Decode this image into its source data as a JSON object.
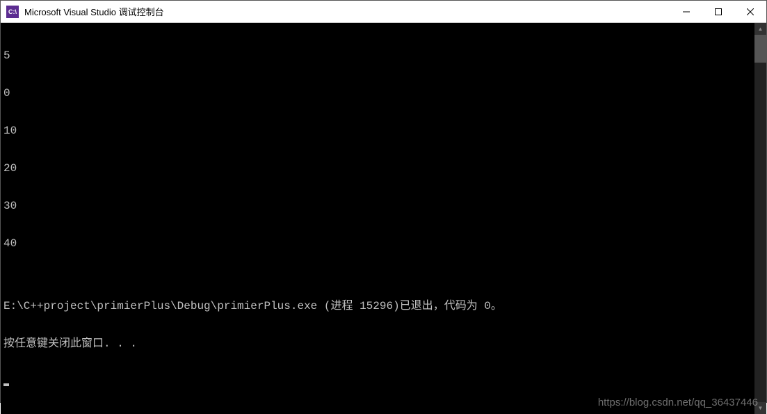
{
  "window": {
    "title": "Microsoft Visual Studio 调试控制台",
    "icon_label": "C:\\"
  },
  "console": {
    "lines": [
      "5",
      "0",
      "10",
      "20",
      "30",
      "40",
      "",
      "E:\\C++project\\primierPlus\\Debug\\primierPlus.exe (进程 15296)已退出，代码为 0。",
      "按任意键关闭此窗口. . ."
    ]
  },
  "watermark": "https://blog.csdn.net/qq_36437446"
}
